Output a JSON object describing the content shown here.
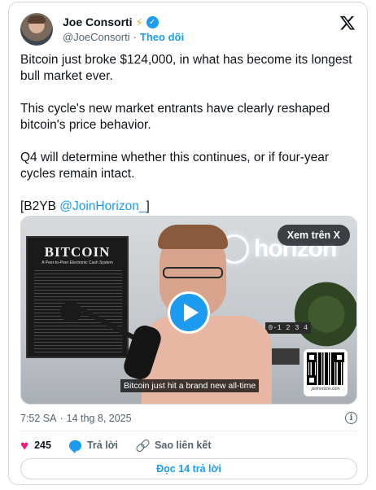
{
  "author": {
    "name": "Joe Consorti",
    "emoji": "⚡",
    "handle": "@JoeConsorti",
    "separator": "·",
    "follow_label": "Theo dõi"
  },
  "tweet": {
    "paragraphs": [
      "Bitcoin just broke $124,000, in what has become its longest bull market ever.",
      "This cycle's new market entrants have clearly reshaped bitcoin's price behavior.",
      "Q4 will determine whether this continues, or if four-year cycles remain intact."
    ],
    "tag_prefix": "[B2YB ",
    "tag_mention": "@JoinHorizon_",
    "tag_suffix": "]"
  },
  "media": {
    "watch_label": "Xem trên X",
    "caption": "Bitcoin just hit a brand new all-time",
    "poster_title": "BITCOIN",
    "poster_subtitle": "A Peer-to-Peer Electronic Cash System",
    "brand_word": "horizon",
    "clock_text": "0·1 2 3 4",
    "qr_label": "joinhorizon.com"
  },
  "meta": {
    "time": "7:52 SA",
    "separator": "·",
    "date": "14 thg 8, 2025",
    "info_glyph": "i"
  },
  "actions": {
    "likes": "245",
    "reply_label": "Trả lời",
    "copy_link_label": "Sao liên kết",
    "read_replies_label": "Đọc 14 trả lời"
  },
  "icons": {
    "x_logo": "x-logo-icon",
    "verified": "verified-badge-icon",
    "heart": "heart-icon",
    "reply": "reply-bubble-icon",
    "link": "link-icon",
    "info": "info-icon",
    "play": "play-icon"
  },
  "colors": {
    "accent": "#1d9bf0",
    "heart": "#f91880",
    "text": "#0f1419",
    "muted": "#536471",
    "border": "#cfd9de"
  }
}
